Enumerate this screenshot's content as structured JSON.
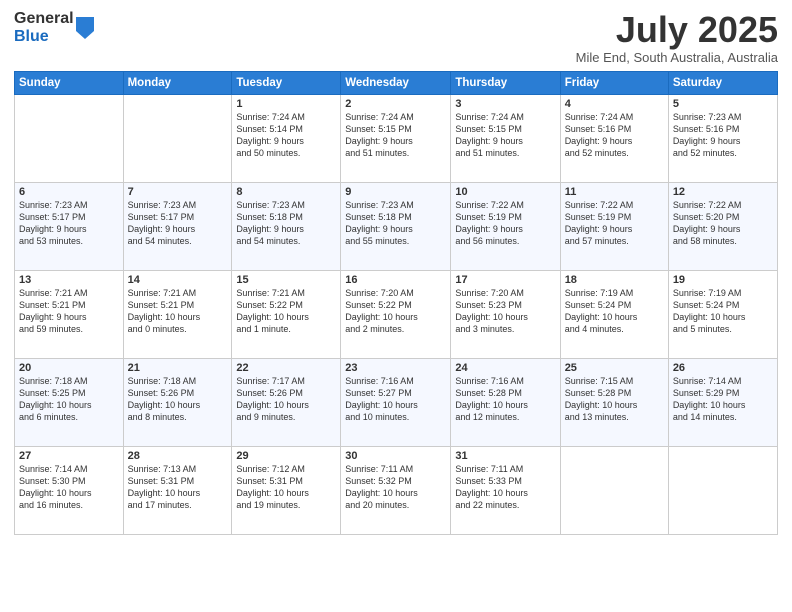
{
  "logo": {
    "general": "General",
    "blue": "Blue"
  },
  "title": {
    "month_year": "July 2025",
    "location": "Mile End, South Australia, Australia"
  },
  "headers": [
    "Sunday",
    "Monday",
    "Tuesday",
    "Wednesday",
    "Thursday",
    "Friday",
    "Saturday"
  ],
  "weeks": [
    [
      {
        "day": "",
        "info": ""
      },
      {
        "day": "",
        "info": ""
      },
      {
        "day": "1",
        "info": "Sunrise: 7:24 AM\nSunset: 5:14 PM\nDaylight: 9 hours\nand 50 minutes."
      },
      {
        "day": "2",
        "info": "Sunrise: 7:24 AM\nSunset: 5:15 PM\nDaylight: 9 hours\nand 51 minutes."
      },
      {
        "day": "3",
        "info": "Sunrise: 7:24 AM\nSunset: 5:15 PM\nDaylight: 9 hours\nand 51 minutes."
      },
      {
        "day": "4",
        "info": "Sunrise: 7:24 AM\nSunset: 5:16 PM\nDaylight: 9 hours\nand 52 minutes."
      },
      {
        "day": "5",
        "info": "Sunrise: 7:23 AM\nSunset: 5:16 PM\nDaylight: 9 hours\nand 52 minutes."
      }
    ],
    [
      {
        "day": "6",
        "info": "Sunrise: 7:23 AM\nSunset: 5:17 PM\nDaylight: 9 hours\nand 53 minutes."
      },
      {
        "day": "7",
        "info": "Sunrise: 7:23 AM\nSunset: 5:17 PM\nDaylight: 9 hours\nand 54 minutes."
      },
      {
        "day": "8",
        "info": "Sunrise: 7:23 AM\nSunset: 5:18 PM\nDaylight: 9 hours\nand 54 minutes."
      },
      {
        "day": "9",
        "info": "Sunrise: 7:23 AM\nSunset: 5:18 PM\nDaylight: 9 hours\nand 55 minutes."
      },
      {
        "day": "10",
        "info": "Sunrise: 7:22 AM\nSunset: 5:19 PM\nDaylight: 9 hours\nand 56 minutes."
      },
      {
        "day": "11",
        "info": "Sunrise: 7:22 AM\nSunset: 5:19 PM\nDaylight: 9 hours\nand 57 minutes."
      },
      {
        "day": "12",
        "info": "Sunrise: 7:22 AM\nSunset: 5:20 PM\nDaylight: 9 hours\nand 58 minutes."
      }
    ],
    [
      {
        "day": "13",
        "info": "Sunrise: 7:21 AM\nSunset: 5:21 PM\nDaylight: 9 hours\nand 59 minutes."
      },
      {
        "day": "14",
        "info": "Sunrise: 7:21 AM\nSunset: 5:21 PM\nDaylight: 10 hours\nand 0 minutes."
      },
      {
        "day": "15",
        "info": "Sunrise: 7:21 AM\nSunset: 5:22 PM\nDaylight: 10 hours\nand 1 minute."
      },
      {
        "day": "16",
        "info": "Sunrise: 7:20 AM\nSunset: 5:22 PM\nDaylight: 10 hours\nand 2 minutes."
      },
      {
        "day": "17",
        "info": "Sunrise: 7:20 AM\nSunset: 5:23 PM\nDaylight: 10 hours\nand 3 minutes."
      },
      {
        "day": "18",
        "info": "Sunrise: 7:19 AM\nSunset: 5:24 PM\nDaylight: 10 hours\nand 4 minutes."
      },
      {
        "day": "19",
        "info": "Sunrise: 7:19 AM\nSunset: 5:24 PM\nDaylight: 10 hours\nand 5 minutes."
      }
    ],
    [
      {
        "day": "20",
        "info": "Sunrise: 7:18 AM\nSunset: 5:25 PM\nDaylight: 10 hours\nand 6 minutes."
      },
      {
        "day": "21",
        "info": "Sunrise: 7:18 AM\nSunset: 5:26 PM\nDaylight: 10 hours\nand 8 minutes."
      },
      {
        "day": "22",
        "info": "Sunrise: 7:17 AM\nSunset: 5:26 PM\nDaylight: 10 hours\nand 9 minutes."
      },
      {
        "day": "23",
        "info": "Sunrise: 7:16 AM\nSunset: 5:27 PM\nDaylight: 10 hours\nand 10 minutes."
      },
      {
        "day": "24",
        "info": "Sunrise: 7:16 AM\nSunset: 5:28 PM\nDaylight: 10 hours\nand 12 minutes."
      },
      {
        "day": "25",
        "info": "Sunrise: 7:15 AM\nSunset: 5:28 PM\nDaylight: 10 hours\nand 13 minutes."
      },
      {
        "day": "26",
        "info": "Sunrise: 7:14 AM\nSunset: 5:29 PM\nDaylight: 10 hours\nand 14 minutes."
      }
    ],
    [
      {
        "day": "27",
        "info": "Sunrise: 7:14 AM\nSunset: 5:30 PM\nDaylight: 10 hours\nand 16 minutes."
      },
      {
        "day": "28",
        "info": "Sunrise: 7:13 AM\nSunset: 5:31 PM\nDaylight: 10 hours\nand 17 minutes."
      },
      {
        "day": "29",
        "info": "Sunrise: 7:12 AM\nSunset: 5:31 PM\nDaylight: 10 hours\nand 19 minutes."
      },
      {
        "day": "30",
        "info": "Sunrise: 7:11 AM\nSunset: 5:32 PM\nDaylight: 10 hours\nand 20 minutes."
      },
      {
        "day": "31",
        "info": "Sunrise: 7:11 AM\nSunset: 5:33 PM\nDaylight: 10 hours\nand 22 minutes."
      },
      {
        "day": "",
        "info": ""
      },
      {
        "day": "",
        "info": ""
      }
    ]
  ]
}
